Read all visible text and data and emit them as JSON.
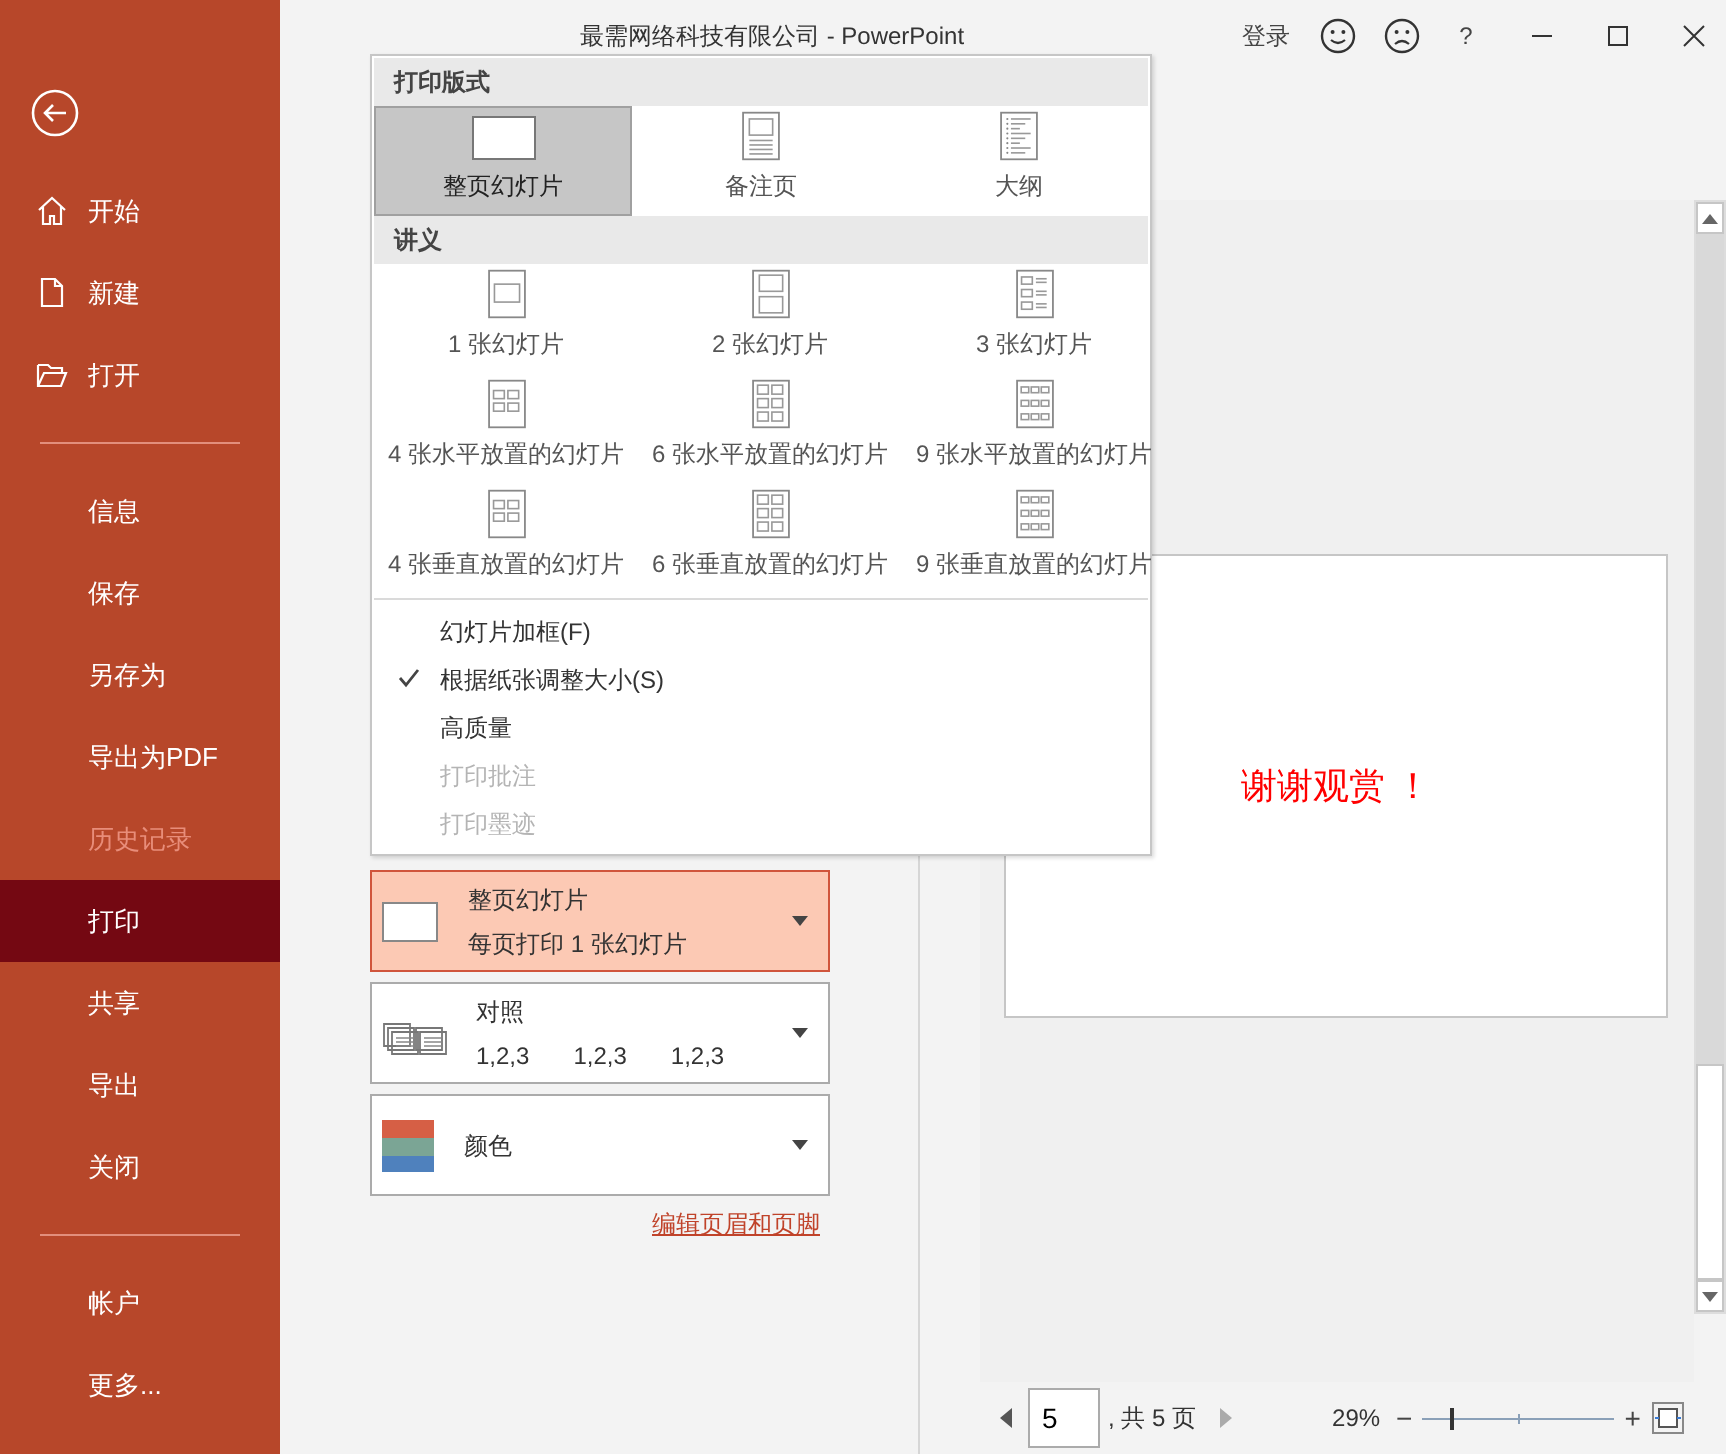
{
  "window": {
    "title": "最需网络科技有限公司  -  PowerPoint",
    "sign_in": "登录",
    "help": "?"
  },
  "sidebar": {
    "groups": [
      [
        {
          "label": "开始",
          "selected": false,
          "disabled": false
        },
        {
          "label": "新建",
          "selected": false,
          "disabled": false
        },
        {
          "label": "打开",
          "selected": false,
          "disabled": false
        }
      ],
      [
        {
          "label": "信息",
          "selected": false,
          "disabled": false
        },
        {
          "label": "保存",
          "selected": false,
          "disabled": false
        },
        {
          "label": "另存为",
          "selected": false,
          "disabled": false
        },
        {
          "label": "导出为PDF",
          "selected": false,
          "disabled": false
        },
        {
          "label": "历史记录",
          "selected": false,
          "disabled": true
        },
        {
          "label": "打印",
          "selected": true,
          "disabled": false
        },
        {
          "label": "共享",
          "selected": false,
          "disabled": false
        },
        {
          "label": "导出",
          "selected": false,
          "disabled": false
        },
        {
          "label": "关闭",
          "selected": false,
          "disabled": false
        }
      ],
      [
        {
          "label": "帐户",
          "selected": false,
          "disabled": false
        },
        {
          "label": "更多...",
          "selected": false,
          "disabled": false
        }
      ]
    ]
  },
  "print_menu": {
    "sections": [
      {
        "heading": "打印版式",
        "options": [
          {
            "label": "整页幻灯片",
            "kind": "full",
            "selected": true
          },
          {
            "label": "备注页",
            "kind": "notes",
            "selected": false
          },
          {
            "label": "大纲",
            "kind": "outline",
            "selected": false
          }
        ]
      },
      {
        "heading": "讲义",
        "options": [
          {
            "label": "1 张幻灯片",
            "kind": "h1",
            "selected": false
          },
          {
            "label": "2 张幻灯片",
            "kind": "h2",
            "selected": false
          },
          {
            "label": "3 张幻灯片",
            "kind": "h3",
            "selected": false
          },
          {
            "label": "4 张水平放置的幻灯片",
            "kind": "g4",
            "selected": false
          },
          {
            "label": "6 张水平放置的幻灯片",
            "kind": "g6",
            "selected": false
          },
          {
            "label": "9 张水平放置的幻灯片",
            "kind": "g9",
            "selected": false
          },
          {
            "label": "4 张垂直放置的幻灯片",
            "kind": "g4",
            "selected": false
          },
          {
            "label": "6 张垂直放置的幻灯片",
            "kind": "g6",
            "selected": false
          },
          {
            "label": "9 张垂直放置的幻灯片",
            "kind": "g9",
            "selected": false
          }
        ]
      }
    ],
    "toggles": [
      {
        "label": "幻灯片加框(F)",
        "checked": false,
        "disabled": false
      },
      {
        "label": "根据纸张调整大小(S)",
        "checked": true,
        "disabled": false
      },
      {
        "label": "高质量",
        "checked": false,
        "disabled": false
      },
      {
        "label": "打印批注",
        "checked": false,
        "disabled": true
      },
      {
        "label": "打印墨迹",
        "checked": false,
        "disabled": true
      }
    ]
  },
  "settings": [
    {
      "kind": "layout",
      "title": "整页幻灯片",
      "lines": [
        "每页打印 1 张幻灯片"
      ],
      "active": true
    },
    {
      "kind": "collate",
      "title": "对照",
      "lines": [
        "1,2,3",
        "1,2,3",
        "1,2,3"
      ],
      "active": false
    },
    {
      "kind": "color",
      "title": "颜色",
      "active": false
    }
  ],
  "header_footer_link": "编辑页眉和页脚",
  "preview": {
    "slide_text": "谢谢观赏 ！"
  },
  "pager": {
    "page": "5",
    "total": ", 共 5 页"
  },
  "zoom": {
    "percent": "29%",
    "out": "−",
    "in": "+",
    "level": 0.14
  }
}
